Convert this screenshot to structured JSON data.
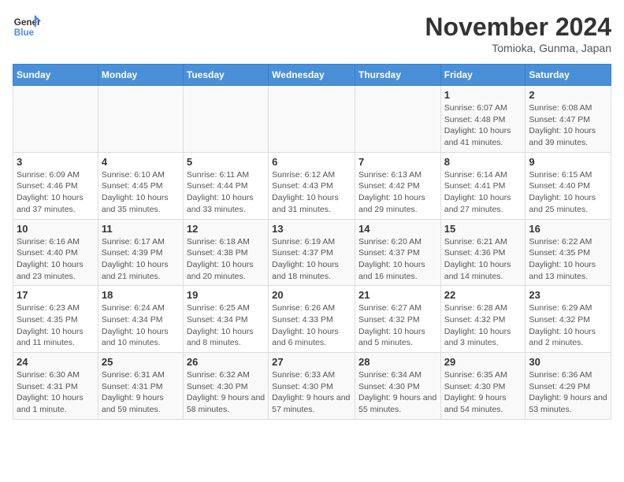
{
  "header": {
    "logo_line1": "General",
    "logo_line2": "Blue",
    "month_title": "November 2024",
    "location": "Tomioka, Gunma, Japan"
  },
  "days_of_week": [
    "Sunday",
    "Monday",
    "Tuesday",
    "Wednesday",
    "Thursday",
    "Friday",
    "Saturday"
  ],
  "weeks": [
    [
      {
        "day": "",
        "info": ""
      },
      {
        "day": "",
        "info": ""
      },
      {
        "day": "",
        "info": ""
      },
      {
        "day": "",
        "info": ""
      },
      {
        "day": "",
        "info": ""
      },
      {
        "day": "1",
        "info": "Sunrise: 6:07 AM\nSunset: 4:48 PM\nDaylight: 10 hours and 41 minutes."
      },
      {
        "day": "2",
        "info": "Sunrise: 6:08 AM\nSunset: 4:47 PM\nDaylight: 10 hours and 39 minutes."
      }
    ],
    [
      {
        "day": "3",
        "info": "Sunrise: 6:09 AM\nSunset: 4:46 PM\nDaylight: 10 hours and 37 minutes."
      },
      {
        "day": "4",
        "info": "Sunrise: 6:10 AM\nSunset: 4:45 PM\nDaylight: 10 hours and 35 minutes."
      },
      {
        "day": "5",
        "info": "Sunrise: 6:11 AM\nSunset: 4:44 PM\nDaylight: 10 hours and 33 minutes."
      },
      {
        "day": "6",
        "info": "Sunrise: 6:12 AM\nSunset: 4:43 PM\nDaylight: 10 hours and 31 minutes."
      },
      {
        "day": "7",
        "info": "Sunrise: 6:13 AM\nSunset: 4:42 PM\nDaylight: 10 hours and 29 minutes."
      },
      {
        "day": "8",
        "info": "Sunrise: 6:14 AM\nSunset: 4:41 PM\nDaylight: 10 hours and 27 minutes."
      },
      {
        "day": "9",
        "info": "Sunrise: 6:15 AM\nSunset: 4:40 PM\nDaylight: 10 hours and 25 minutes."
      }
    ],
    [
      {
        "day": "10",
        "info": "Sunrise: 6:16 AM\nSunset: 4:40 PM\nDaylight: 10 hours and 23 minutes."
      },
      {
        "day": "11",
        "info": "Sunrise: 6:17 AM\nSunset: 4:39 PM\nDaylight: 10 hours and 21 minutes."
      },
      {
        "day": "12",
        "info": "Sunrise: 6:18 AM\nSunset: 4:38 PM\nDaylight: 10 hours and 20 minutes."
      },
      {
        "day": "13",
        "info": "Sunrise: 6:19 AM\nSunset: 4:37 PM\nDaylight: 10 hours and 18 minutes."
      },
      {
        "day": "14",
        "info": "Sunrise: 6:20 AM\nSunset: 4:37 PM\nDaylight: 10 hours and 16 minutes."
      },
      {
        "day": "15",
        "info": "Sunrise: 6:21 AM\nSunset: 4:36 PM\nDaylight: 10 hours and 14 minutes."
      },
      {
        "day": "16",
        "info": "Sunrise: 6:22 AM\nSunset: 4:35 PM\nDaylight: 10 hours and 13 minutes."
      }
    ],
    [
      {
        "day": "17",
        "info": "Sunrise: 6:23 AM\nSunset: 4:35 PM\nDaylight: 10 hours and 11 minutes."
      },
      {
        "day": "18",
        "info": "Sunrise: 6:24 AM\nSunset: 4:34 PM\nDaylight: 10 hours and 10 minutes."
      },
      {
        "day": "19",
        "info": "Sunrise: 6:25 AM\nSunset: 4:34 PM\nDaylight: 10 hours and 8 minutes."
      },
      {
        "day": "20",
        "info": "Sunrise: 6:26 AM\nSunset: 4:33 PM\nDaylight: 10 hours and 6 minutes."
      },
      {
        "day": "21",
        "info": "Sunrise: 6:27 AM\nSunset: 4:32 PM\nDaylight: 10 hours and 5 minutes."
      },
      {
        "day": "22",
        "info": "Sunrise: 6:28 AM\nSunset: 4:32 PM\nDaylight: 10 hours and 3 minutes."
      },
      {
        "day": "23",
        "info": "Sunrise: 6:29 AM\nSunset: 4:32 PM\nDaylight: 10 hours and 2 minutes."
      }
    ],
    [
      {
        "day": "24",
        "info": "Sunrise: 6:30 AM\nSunset: 4:31 PM\nDaylight: 10 hours and 1 minute."
      },
      {
        "day": "25",
        "info": "Sunrise: 6:31 AM\nSunset: 4:31 PM\nDaylight: 9 hours and 59 minutes."
      },
      {
        "day": "26",
        "info": "Sunrise: 6:32 AM\nSunset: 4:30 PM\nDaylight: 9 hours and 58 minutes."
      },
      {
        "day": "27",
        "info": "Sunrise: 6:33 AM\nSunset: 4:30 PM\nDaylight: 9 hours and 57 minutes."
      },
      {
        "day": "28",
        "info": "Sunrise: 6:34 AM\nSunset: 4:30 PM\nDaylight: 9 hours and 55 minutes."
      },
      {
        "day": "29",
        "info": "Sunrise: 6:35 AM\nSunset: 4:30 PM\nDaylight: 9 hours and 54 minutes."
      },
      {
        "day": "30",
        "info": "Sunrise: 6:36 AM\nSunset: 4:29 PM\nDaylight: 9 hours and 53 minutes."
      }
    ]
  ]
}
